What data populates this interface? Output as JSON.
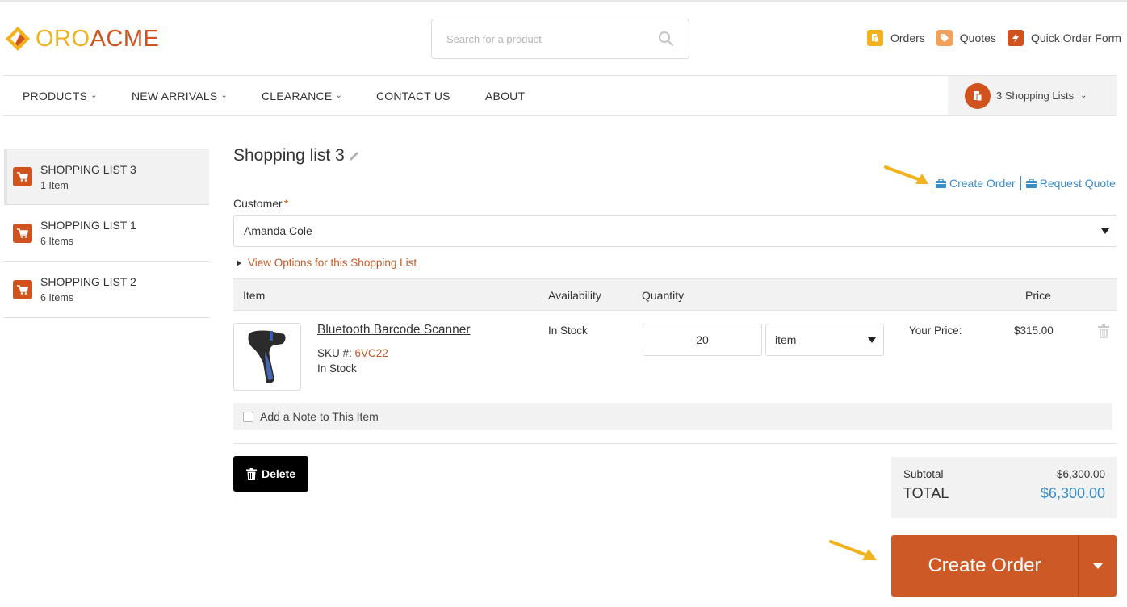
{
  "header": {
    "logo_part1": "ORO",
    "logo_part2": "ACME",
    "search_placeholder": "Search for a product",
    "links": {
      "orders": "Orders",
      "quotes": "Quotes",
      "quick_order_form": "Quick Order Form"
    }
  },
  "nav": {
    "products": "PRODUCTS",
    "new_arrivals": "NEW ARRIVALS",
    "clearance": "CLEARANCE",
    "contact_us": "CONTACT US",
    "about": "ABOUT",
    "shopping_lists_widget": "3 Shopping Lists"
  },
  "sidebar": {
    "items": [
      {
        "title": "SHOPPING LIST 3",
        "count": "1 Item",
        "active": true
      },
      {
        "title": "SHOPPING LIST 1",
        "count": "6 Items",
        "active": false
      },
      {
        "title": "SHOPPING LIST 2",
        "count": "6 Items",
        "active": false
      }
    ]
  },
  "main": {
    "title": "Shopping list 3",
    "actions": {
      "create_order": "Create Order",
      "request_quote": "Request Quote"
    },
    "customer": {
      "label": "Customer",
      "required_mark": "*",
      "value": "Amanda Cole"
    },
    "view_options": "View Options for this Shopping List",
    "table": {
      "headers": {
        "item": "Item",
        "availability": "Availability",
        "quantity": "Quantity",
        "price": "Price"
      },
      "rows": [
        {
          "name": "Bluetooth Barcode Scanner",
          "sku_label": "SKU #:",
          "sku": "6VC22",
          "stock": "In Stock",
          "availability": "In Stock",
          "quantity": "20",
          "unit": "item",
          "price_label": "Your Price:",
          "price": "$315.00"
        }
      ]
    },
    "note_label": "Add a Note to This Item",
    "delete_label": "Delete",
    "totals": {
      "subtotal_label": "Subtotal",
      "subtotal": "$6,300.00",
      "total_label": "TOTAL",
      "total": "$6,300.00"
    },
    "create_order_button": "Create Order"
  },
  "colors": {
    "brand_orange": "#d0521c",
    "brand_yellow": "#f2b21d",
    "link_blue": "#3a8dc9",
    "annotation_arrow": "#f2b21d"
  }
}
